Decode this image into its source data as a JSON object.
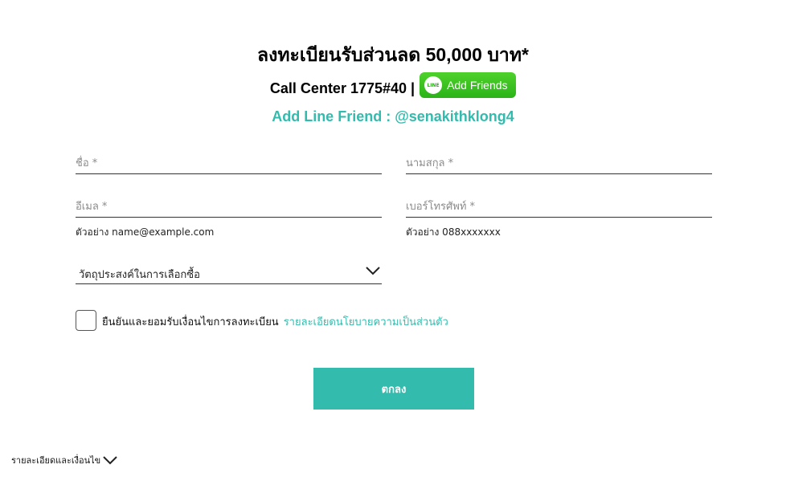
{
  "header": {
    "title": "ลงทะเบียนรับส่วนลด 50,000 บาท*",
    "call_center": "Call Center 1775#40 |",
    "line_button_logo": "LINE",
    "line_button_label": "Add Friends",
    "line_friend": "Add Line Friend : @senakithklong4"
  },
  "form": {
    "first_name": {
      "placeholder": "ชื่อ *",
      "value": ""
    },
    "last_name": {
      "placeholder": "นามสกุล *",
      "value": ""
    },
    "email": {
      "placeholder": "อีเมล *",
      "value": "",
      "hint": "ตัวอย่าง name@example.com"
    },
    "phone": {
      "placeholder": "เบอร์โทรศัพท์ *",
      "value": "",
      "hint": "ตัวอย่าง 088xxxxxxx"
    },
    "purpose": {
      "selected": "วัตถุประสงค์ในการเลือกซื้อ"
    },
    "consent": {
      "label": "ยืนยันและยอมรับเงื่อนไขการลงทะเบียน",
      "link": "รายละเอียดนโยบายความเป็นส่วนตัว",
      "checked": false
    },
    "submit_label": "ตกลง"
  },
  "footer": {
    "terms_label": "รายละเอียดและเงื่อนไข"
  },
  "colors": {
    "accent": "#33bbad",
    "line_green": "#2ab318"
  },
  "icons": {
    "dropdown": "chevron-down-icon",
    "line": "line-logo-icon"
  }
}
